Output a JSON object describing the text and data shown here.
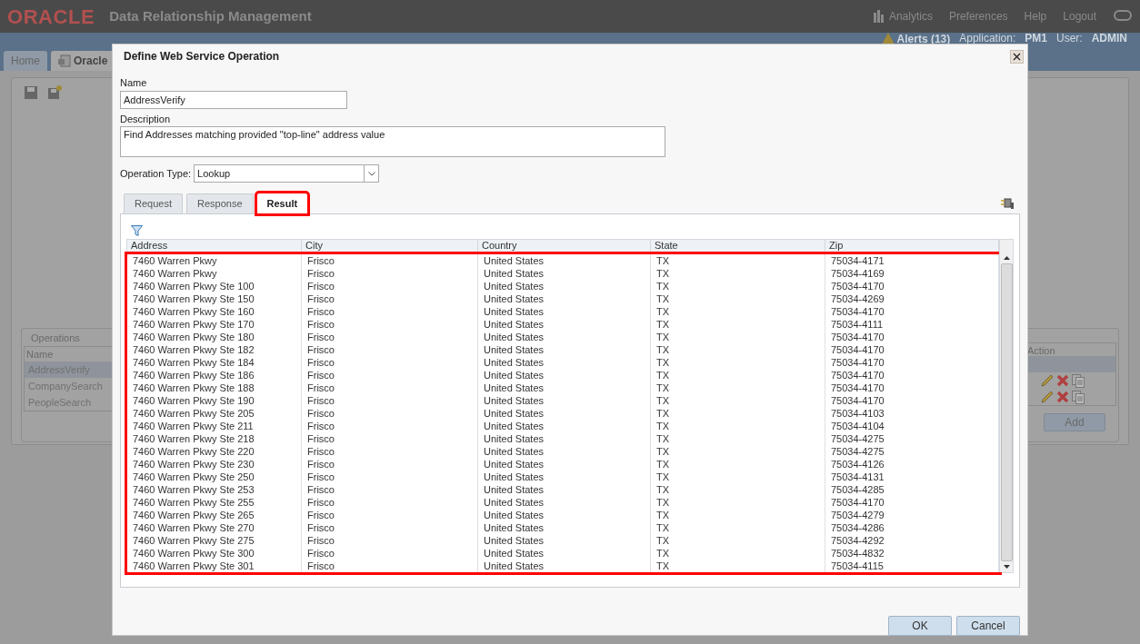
{
  "header": {
    "logo": "ORACLE",
    "title": "Data Relationship Management",
    "nav": [
      "Analytics",
      "Preferences",
      "Help",
      "Logout"
    ]
  },
  "status": {
    "alerts": "Alerts (13)",
    "application_label": "Application:",
    "application": "PM1",
    "user_label": "User:",
    "user": "ADMIN"
  },
  "tabs": [
    {
      "label": "Home",
      "selected": false
    },
    {
      "label": "Oracle",
      "selected": true
    }
  ],
  "operations": {
    "title": "Operations",
    "columns": [
      "Name",
      "Action"
    ],
    "rows": [
      {
        "name": "AddressVerify",
        "selected": true,
        "actions": false
      },
      {
        "name": "CompanySearch",
        "selected": false,
        "actions": true
      },
      {
        "name": "PeopleSearch",
        "selected": false,
        "actions": true
      }
    ],
    "add_button": "Add"
  },
  "dialog": {
    "title": "Define Web Service Operation",
    "name_label": "Name",
    "name_value": "AddressVerify",
    "description_label": "Description",
    "description_value": "Find Addresses matching provided \"top-line\" address value",
    "operation_type_label": "Operation Type:",
    "operation_type_value": "Lookup",
    "tabs": [
      {
        "label": "Request",
        "selected": false,
        "highlighted": false
      },
      {
        "label": "Response",
        "selected": false,
        "highlighted": false
      },
      {
        "label": "Result",
        "selected": true,
        "highlighted": true
      }
    ],
    "results": {
      "highlighted": true,
      "columns": [
        "Address",
        "City",
        "Country",
        "State",
        "Zip"
      ],
      "rows": [
        [
          "7460 Warren Pkwy",
          "Frisco",
          "United States",
          "TX",
          "75034-4171"
        ],
        [
          "7460 Warren Pkwy",
          "Frisco",
          "United States",
          "TX",
          "75034-4169"
        ],
        [
          "7460 Warren Pkwy Ste 100",
          "Frisco",
          "United States",
          "TX",
          "75034-4170"
        ],
        [
          "7460 Warren Pkwy Ste 150",
          "Frisco",
          "United States",
          "TX",
          "75034-4269"
        ],
        [
          "7460 Warren Pkwy Ste 160",
          "Frisco",
          "United States",
          "TX",
          "75034-4170"
        ],
        [
          "7460 Warren Pkwy Ste 170",
          "Frisco",
          "United States",
          "TX",
          "75034-4111"
        ],
        [
          "7460 Warren Pkwy Ste 180",
          "Frisco",
          "United States",
          "TX",
          "75034-4170"
        ],
        [
          "7460 Warren Pkwy Ste 182",
          "Frisco",
          "United States",
          "TX",
          "75034-4170"
        ],
        [
          "7460 Warren Pkwy Ste 184",
          "Frisco",
          "United States",
          "TX",
          "75034-4170"
        ],
        [
          "7460 Warren Pkwy Ste 186",
          "Frisco",
          "United States",
          "TX",
          "75034-4170"
        ],
        [
          "7460 Warren Pkwy Ste 188",
          "Frisco",
          "United States",
          "TX",
          "75034-4170"
        ],
        [
          "7460 Warren Pkwy Ste 190",
          "Frisco",
          "United States",
          "TX",
          "75034-4170"
        ],
        [
          "7460 Warren Pkwy Ste 205",
          "Frisco",
          "United States",
          "TX",
          "75034-4103"
        ],
        [
          "7460 Warren Pkwy Ste 211",
          "Frisco",
          "United States",
          "TX",
          "75034-4104"
        ],
        [
          "7460 Warren Pkwy Ste 218",
          "Frisco",
          "United States",
          "TX",
          "75034-4275"
        ],
        [
          "7460 Warren Pkwy Ste 220",
          "Frisco",
          "United States",
          "TX",
          "75034-4275"
        ],
        [
          "7460 Warren Pkwy Ste 230",
          "Frisco",
          "United States",
          "TX",
          "75034-4126"
        ],
        [
          "7460 Warren Pkwy Ste 250",
          "Frisco",
          "United States",
          "TX",
          "75034-4131"
        ],
        [
          "7460 Warren Pkwy Ste 253",
          "Frisco",
          "United States",
          "TX",
          "75034-4285"
        ],
        [
          "7460 Warren Pkwy Ste 255",
          "Frisco",
          "United States",
          "TX",
          "75034-4170"
        ],
        [
          "7460 Warren Pkwy Ste 265",
          "Frisco",
          "United States",
          "TX",
          "75034-4279"
        ],
        [
          "7460 Warren Pkwy Ste 270",
          "Frisco",
          "United States",
          "TX",
          "75034-4286"
        ],
        [
          "7460 Warren Pkwy Ste 275",
          "Frisco",
          "United States",
          "TX",
          "75034-4292"
        ],
        [
          "7460 Warren Pkwy Ste 300",
          "Frisco",
          "United States",
          "TX",
          "75034-4832"
        ],
        [
          "7460 Warren Pkwy Ste 301",
          "Frisco",
          "United States",
          "TX",
          "75034-4115"
        ]
      ]
    },
    "buttons": [
      "OK",
      "Cancel"
    ]
  }
}
